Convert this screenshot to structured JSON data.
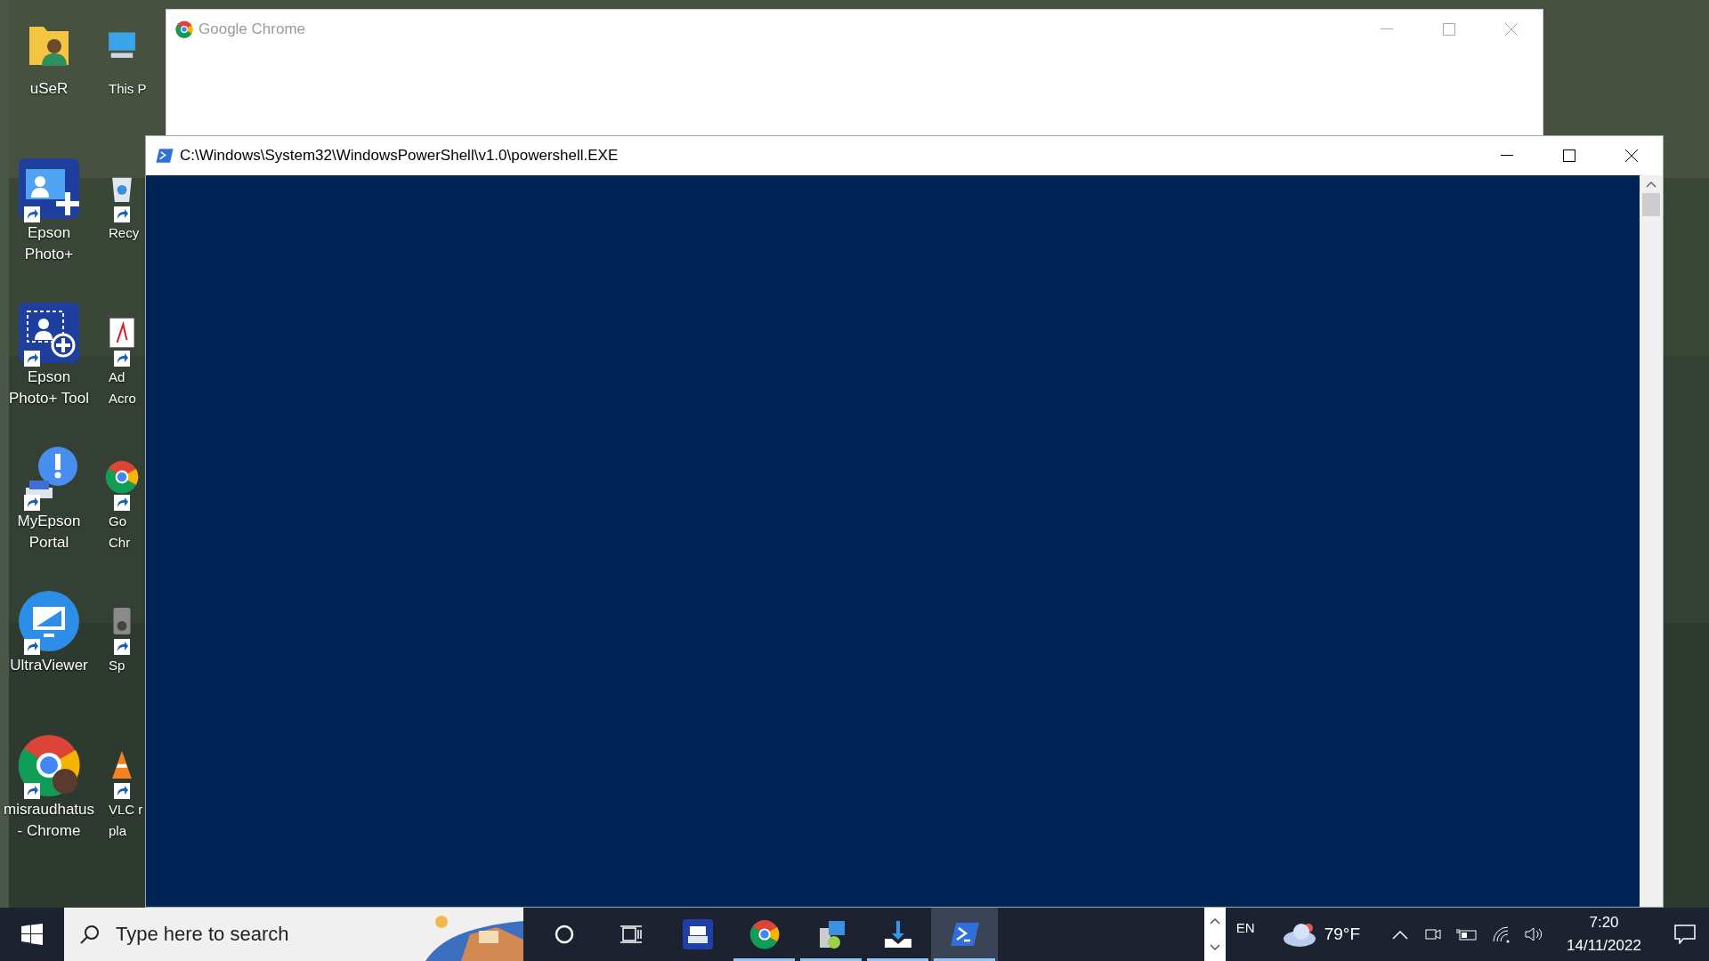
{
  "desktop_column_1": [
    {
      "kind": "user-folder",
      "lines": [
        "uSeR"
      ]
    },
    {
      "kind": "epson-photo",
      "lines": [
        "Epson",
        "Photo+"
      ]
    },
    {
      "kind": "epson-tool",
      "lines": [
        "Epson",
        "Photo+ Tool"
      ]
    },
    {
      "kind": "myepson",
      "lines": [
        "MyEpson",
        "Portal"
      ]
    },
    {
      "kind": "ultraviewer",
      "lines": [
        "UltraViewer"
      ]
    },
    {
      "kind": "chrome-profile",
      "lines": [
        "misraudhatus",
        "- Chrome"
      ]
    }
  ],
  "desktop_column_2": [
    {
      "kind": "pc",
      "lines": [
        "This P"
      ]
    },
    {
      "kind": "recycle",
      "lines": [
        "Recy"
      ]
    },
    {
      "kind": "acrobat",
      "lines": [
        "Ad",
        "Acro"
      ]
    },
    {
      "kind": "chrome",
      "lines": [
        "Go",
        "Chr"
      ]
    },
    {
      "kind": "speaker",
      "lines": [
        "Sp"
      ]
    },
    {
      "kind": "vlc",
      "lines": [
        "VLC r",
        "pla"
      ]
    }
  ],
  "chrome_window": {
    "title": "Google Chrome"
  },
  "powershell_window": {
    "title": "C:\\Windows\\System32\\WindowsPowerShell\\v1.0\\powershell.EXE"
  },
  "taskbar": {
    "search": {
      "placeholder": "Type here to search"
    },
    "apps": [
      {
        "kind": "cortana",
        "running": false,
        "selected": false
      },
      {
        "kind": "task-view",
        "running": false,
        "selected": false
      },
      {
        "kind": "scanner",
        "running": false,
        "selected": false
      },
      {
        "kind": "chrome",
        "running": true,
        "selected": false
      },
      {
        "kind": "installer",
        "running": true,
        "selected": false
      },
      {
        "kind": "download",
        "running": true,
        "selected": false
      },
      {
        "kind": "powershell",
        "running": true,
        "selected": true
      }
    ],
    "language": "EN",
    "temperature": "79°F",
    "time": "7:20",
    "date": "14/11/2022"
  }
}
